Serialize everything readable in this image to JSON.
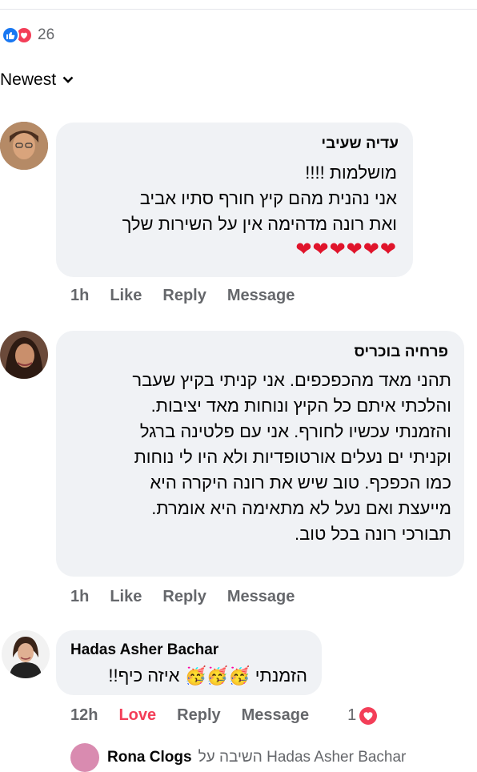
{
  "reactions": {
    "count": "26"
  },
  "sort": {
    "label": "Newest"
  },
  "comments": [
    {
      "author": "עדיה שעיבי",
      "lines": [
        "מושלמות !!!!",
        "אני נהנית מהם קיץ חורף סתיו אביב",
        "ואת רונה מדהימה אין על השירות שלך"
      ],
      "hearts": "❤❤❤❤❤❤",
      "time": "1h",
      "like": "Like",
      "reply": "Reply",
      "message": "Message"
    },
    {
      "author": "פרחיה בוכריס",
      "lines": [
        "תהני מאד מהכפכפים. אני קניתי בקיץ שעבר",
        "והלכתי איתם כל הקיץ ונוחות מאד יציבות.",
        "והזמנתי עכשיו לחורף. אני עם פלטינה ברגל",
        "וקניתי ים נעלים אורטופדיות ולא היו לי נוחות",
        "כמו הכפכף. טוב שיש את רונה היקרה היא",
        "מייעצת ואם נעל לא מתאימה היא אומרת.",
        "תבורכי רונה בכל טוב."
      ],
      "time": "1h",
      "like": "Like",
      "reply": "Reply",
      "message": "Message"
    },
    {
      "author": "Hadas Asher Bachar",
      "text": "הזמנתי 🥳🥳🥳 איזה כיף!!",
      "time": "12h",
      "like": "Love",
      "reply": "Reply",
      "message": "Message",
      "reaction_count": "1"
    }
  ],
  "reply_preview": {
    "author": "Rona Clogs",
    "text": "השיבה על Hadas Asher Bachar"
  },
  "colors": {
    "accent": "#1877f2",
    "love": "#f33e58",
    "muted": "#65676b",
    "bubble": "#f0f2f5"
  }
}
